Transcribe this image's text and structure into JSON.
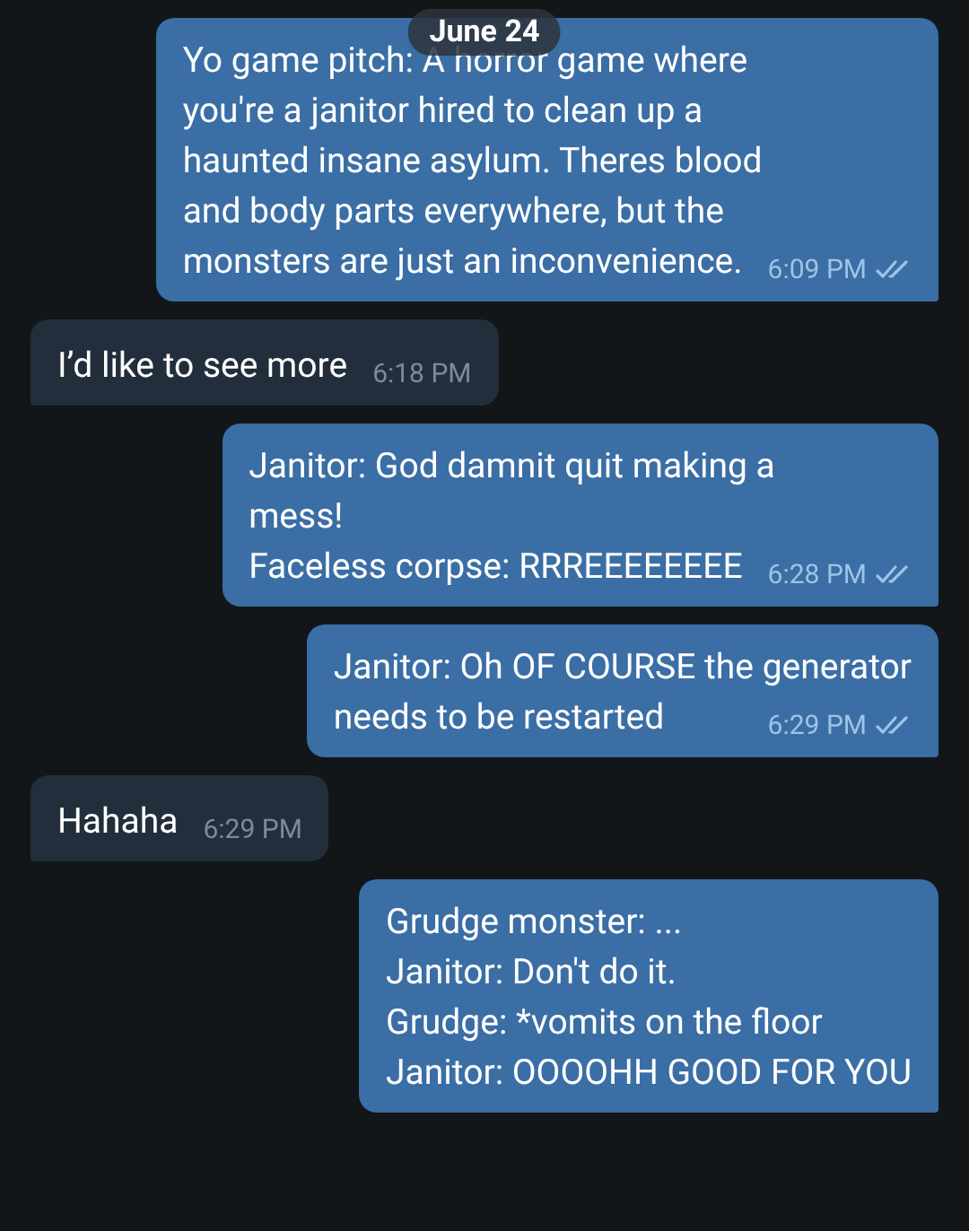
{
  "date_badge": "June 24",
  "messages": [
    {
      "kind": "outgoing",
      "lines": [
        "Yo game pitch: A horror game where",
        "you're a janitor hired to clean up a",
        "haunted insane asylum. Theres blood",
        "and body parts everywhere, but the",
        "monsters are just an inconvenience."
      ],
      "time": "6:09 PM",
      "read": true
    },
    {
      "kind": "incoming",
      "lines": [
        "I’d like to see more"
      ],
      "time": "6:18 PM"
    },
    {
      "kind": "outgoing",
      "lines": [
        "Janitor: God damnit quit making a",
        "mess!",
        "Faceless corpse: RRREEEEEEEE"
      ],
      "time": "6:28 PM",
      "read": true
    },
    {
      "kind": "outgoing",
      "lines": [
        "Janitor: Oh OF COURSE the generator",
        "needs to be restarted"
      ],
      "time": "6:29 PM",
      "read": true
    },
    {
      "kind": "incoming",
      "lines": [
        "Hahaha"
      ],
      "time": "6:29 PM"
    },
    {
      "kind": "outgoing",
      "lines": [
        "Grudge monster: ...",
        "Janitor: Don't do it.",
        "Grudge: *vomits on the floor",
        "Janitor: OOOOHH GOOD FOR YOU"
      ]
    }
  ]
}
